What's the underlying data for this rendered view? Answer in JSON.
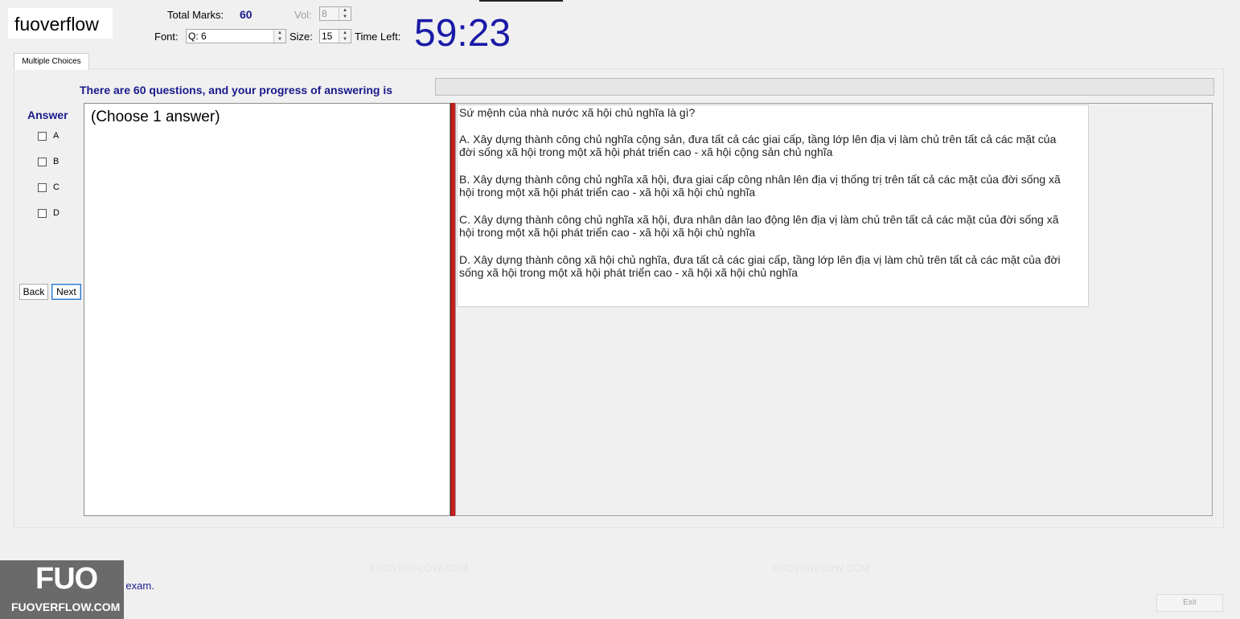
{
  "header": {
    "logo_text": "fuoverflow",
    "total_marks_label": "Total Marks:",
    "total_marks_value": "60",
    "vol_label": "Vol:",
    "vol_value": "8",
    "font_label": "Font:",
    "font_value": "Q: 6",
    "size_label": "Size:",
    "size_value": "15",
    "time_left_label": "Time Left:",
    "timer": "59:23"
  },
  "tabs": [
    {
      "label": "Multiple Choices"
    }
  ],
  "progress": {
    "text": "There are 60 questions, and your progress of answering is",
    "fraction": 0
  },
  "answer": {
    "title": "Answer",
    "options": [
      "A",
      "B",
      "C",
      "D"
    ],
    "back_label": "Back",
    "next_label": "Next"
  },
  "left_pane": {
    "instruction": "(Choose 1 answer)"
  },
  "question": {
    "title": "Sứ mệnh của nhà nước xã hội chủ nghĩa là gì?",
    "choices": [
      "A.  Xây dựng thành công chủ nghĩa cộng sản, đưa tất cả các giai cấp, tầng lớp lên địa vị làm chủ trên tất cả các mặt của đời sống xã hội trong một xã hội phát triển cao - xã hội cộng sản chủ nghĩa",
      "B.  Xây dựng thành công chủ nghĩa xã hội, đưa giai cấp công nhân lên địa vị thống trị trên tất cả các mặt của đời sống xã hội trong một xã hội phát triển cao - xã hội xã hội chủ nghĩa",
      "C.  Xây dựng thành công chủ nghĩa xã hội, đưa nhân dân lao động lên địa vị làm chủ trên tất cả các mặt của đời sống xã hội trong một xã hội phát triển cao - xã hội xã hội chủ nghĩa",
      "D.  Xây dựng thành công xã hội chủ nghĩa, đưa tất cả các giai cấp, tầng lớp lên địa vị làm chủ trên tất cả các mặt của đời sống xã hội trong một xã hội phát triển cao - xã hội xã hội chủ nghĩa"
    ]
  },
  "watermark": {
    "text": "FUOVERFLOW.COM"
  },
  "footer": {
    "finish_label": "I want to finish the exam.",
    "exit_label": "Exit",
    "badge_big": "FUO",
    "badge_small": "FUOVERFLOW.COM"
  },
  "colors": {
    "accent_blue": "#1a1a8c",
    "timer_blue": "#1a1aa8",
    "splitter_red": "#c41e1e"
  }
}
